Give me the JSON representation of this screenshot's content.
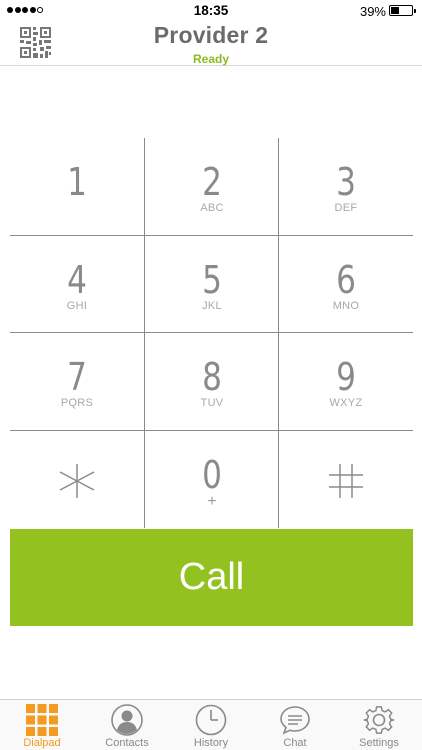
{
  "status_bar": {
    "time": "18:35",
    "battery": "39%",
    "battery_level": 0.39
  },
  "header": {
    "title": "Provider 2",
    "status": "Ready",
    "status_color": "#8dba20",
    "qr_icon": "qr-code-icon"
  },
  "keypad": {
    "keys": [
      {
        "digit": "1",
        "letters": ""
      },
      {
        "digit": "2",
        "letters": "ABC"
      },
      {
        "digit": "3",
        "letters": "DEF"
      },
      {
        "digit": "4",
        "letters": "GHI"
      },
      {
        "digit": "5",
        "letters": "JKL"
      },
      {
        "digit": "6",
        "letters": "MNO"
      },
      {
        "digit": "7",
        "letters": "PQRS"
      },
      {
        "digit": "8",
        "letters": "TUV"
      },
      {
        "digit": "9",
        "letters": "WXYZ"
      },
      {
        "digit": "*",
        "letters": ""
      },
      {
        "digit": "0",
        "letters": "+"
      },
      {
        "digit": "#",
        "letters": ""
      }
    ]
  },
  "call_button": {
    "label": "Call",
    "color": "#93c120"
  },
  "tabs": [
    {
      "label": "Dialpad",
      "icon": "dialpad-icon",
      "active": true
    },
    {
      "label": "Contacts",
      "icon": "contacts-icon",
      "active": false
    },
    {
      "label": "History",
      "icon": "history-icon",
      "active": false
    },
    {
      "label": "Chat",
      "icon": "chat-icon",
      "active": false
    },
    {
      "label": "Settings",
      "icon": "settings-icon",
      "active": false
    }
  ],
  "colors": {
    "accent": "#93c120",
    "active_tab": "#f39a1f",
    "inactive_tab": "#8a8a8a"
  }
}
